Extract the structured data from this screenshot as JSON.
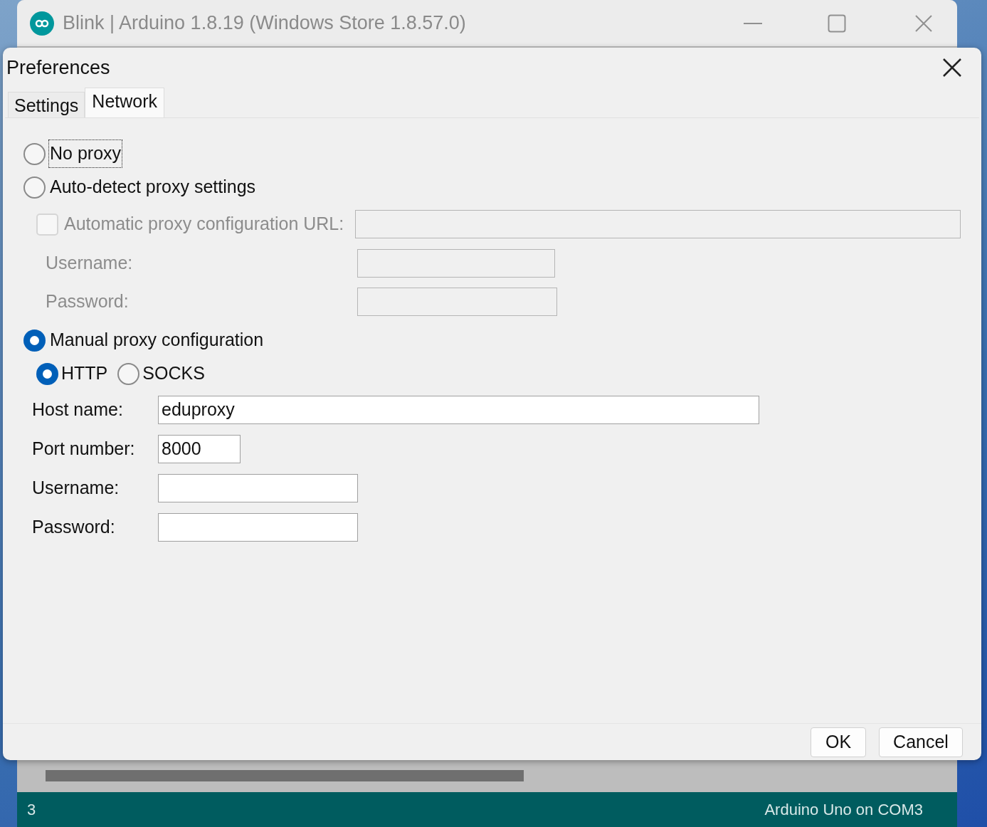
{
  "main_window": {
    "title": "Blink | Arduino 1.8.19 (Windows Store 1.8.57.0)",
    "status_bar": {
      "line": "3",
      "board": "Arduino Uno on COM3"
    }
  },
  "dialog": {
    "title": "Preferences",
    "tabs": [
      {
        "label": "Settings",
        "selected": false
      },
      {
        "label": "Network",
        "selected": true
      }
    ],
    "no_proxy": {
      "label": "No proxy",
      "selected": false,
      "focused": true
    },
    "auto_detect": {
      "label": "Auto-detect proxy settings",
      "selected": false,
      "pac_url": {
        "label": "Automatic proxy configuration URL:",
        "checked": false,
        "disabled": true
      },
      "fields": [
        {
          "label": "Username:",
          "disabled": true
        },
        {
          "label": "Password:",
          "disabled": true
        }
      ]
    },
    "manual": {
      "label": "Manual proxy configuration",
      "selected": true,
      "protocols": [
        {
          "label": "HTTP",
          "selected": true
        },
        {
          "label": "SOCKS",
          "selected": false
        }
      ],
      "fields": [
        {
          "label": "Host name:",
          "value": "eduproxy"
        },
        {
          "label": "Port number:",
          "value": "8000"
        },
        {
          "label": "Username:"
        },
        {
          "label": "Password:"
        }
      ]
    },
    "buttons": [
      "OK",
      "Cancel"
    ]
  }
}
